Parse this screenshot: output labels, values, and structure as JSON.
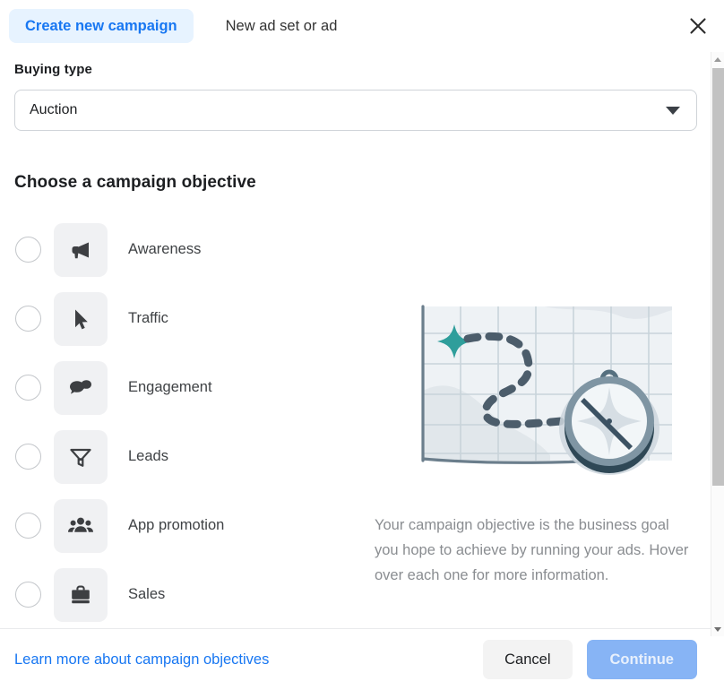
{
  "header": {
    "active_tab_label": "Create new campaign",
    "secondary_tab_label": "New ad set or ad",
    "close_icon": "close-icon"
  },
  "buying_type": {
    "label": "Buying type",
    "selected_value": "Auction",
    "caret_icon": "chevron-down-icon"
  },
  "objective_section": {
    "heading": "Choose a campaign objective",
    "items": [
      {
        "label": "Awareness",
        "icon": "megaphone-icon",
        "selected": false
      },
      {
        "label": "Traffic",
        "icon": "cursor-icon",
        "selected": false
      },
      {
        "label": "Engagement",
        "icon": "chat-bubbles-icon",
        "selected": false
      },
      {
        "label": "Leads",
        "icon": "funnel-icon",
        "selected": false
      },
      {
        "label": "App promotion",
        "icon": "people-icon",
        "selected": false
      },
      {
        "label": "Sales",
        "icon": "briefcase-icon",
        "selected": false
      }
    ]
  },
  "info_panel": {
    "illustration": "map-with-compass-illustration",
    "description": "Your campaign objective is the business goal you hope to achieve by running your ads. Hover over each one for more information."
  },
  "footer": {
    "learn_more_label": "Learn more about campaign objectives",
    "cancel_label": "Cancel",
    "continue_label": "Continue",
    "continue_disabled": true
  },
  "colors": {
    "accent_blue": "#1877f2",
    "tab_active_bg": "#e7f3ff",
    "continue_disabled_bg": "#87b4f5",
    "icon_tile_bg": "#f0f1f3",
    "text_primary": "#1c1e21",
    "text_muted": "#8a8d91",
    "illustration_teal": "#2f9e9b",
    "illustration_slate": "#4a5d6e"
  }
}
